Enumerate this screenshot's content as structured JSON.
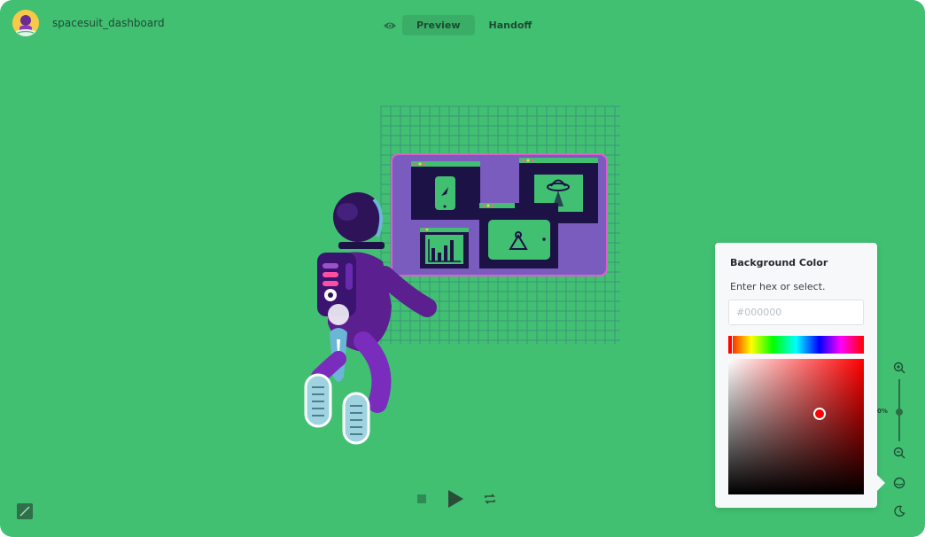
{
  "header": {
    "file_name": "spacesuit_dashboard",
    "tabs": [
      {
        "label": "Preview",
        "active": true
      },
      {
        "label": "Handoff",
        "active": false
      }
    ],
    "icons": {
      "avatar": "user-avatar",
      "preview_toggle": "eye-icon"
    }
  },
  "player": {
    "icons": [
      "stop-icon",
      "play-icon",
      "loop-icon"
    ]
  },
  "color_panel": {
    "title": "Background Color",
    "hint": "Enter hex or select.",
    "hex_placeholder": "#000000",
    "selected_color": "#ff0000"
  },
  "zoom": {
    "value_label": "0%",
    "icons": [
      "zoom-in-icon",
      "zoom-out-icon"
    ]
  },
  "side_icons": [
    "background-color-icon",
    "dark-mode-icon"
  ],
  "colors": {
    "canvas_bg": "#41c072",
    "panel_bg": "#f6f8f9",
    "accent": "#3aae67"
  }
}
